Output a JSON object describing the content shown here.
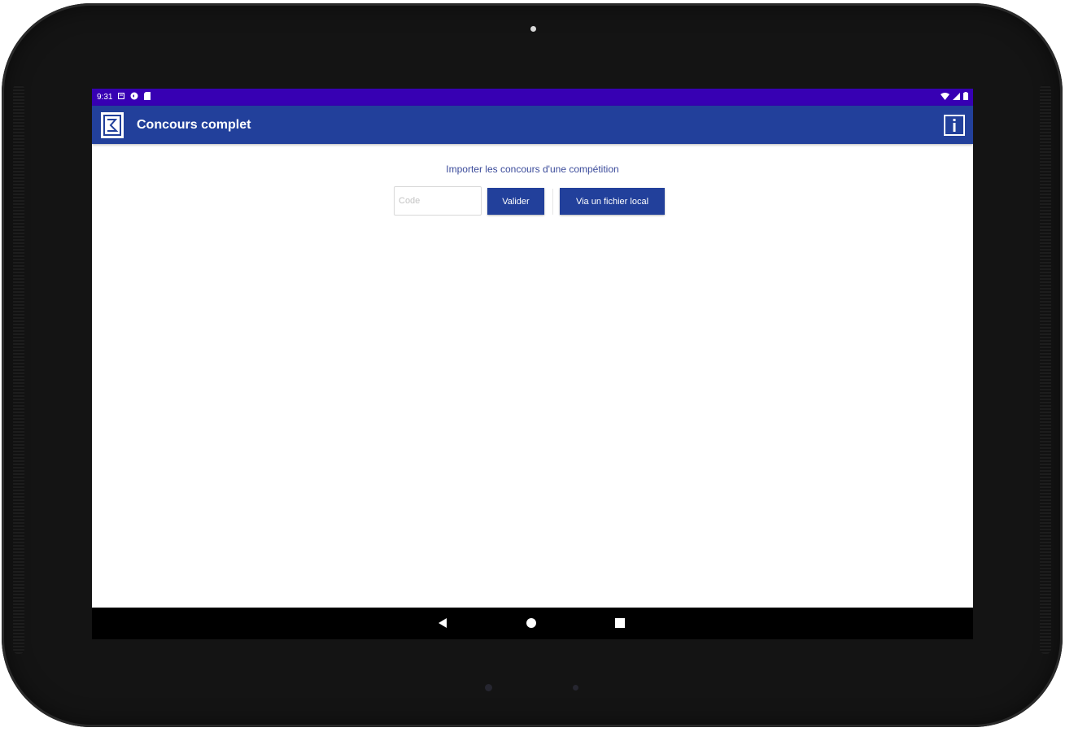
{
  "status_bar": {
    "time": "9:31",
    "icons_left": [
      "notification-icon",
      "sync-icon",
      "sd-card-icon"
    ],
    "icons_right": [
      "wifi-icon",
      "signal-icon",
      "battery-icon"
    ]
  },
  "app_bar": {
    "title": "Concours complet",
    "logo_icon": "app-logo-icon",
    "info_icon": "info-icon"
  },
  "import_section": {
    "title": "Importer les concours d'une compétition",
    "code_placeholder": "Code",
    "validate_label": "Valider",
    "local_file_label": "Via un fichier local"
  },
  "navigation": {
    "icons": [
      "back-icon",
      "home-icon",
      "recents-icon"
    ]
  },
  "colors": {
    "status_bar": "#3700b3",
    "app_bar": "#22409b",
    "button": "#22409b",
    "heading_text": "#3a4a9a"
  }
}
